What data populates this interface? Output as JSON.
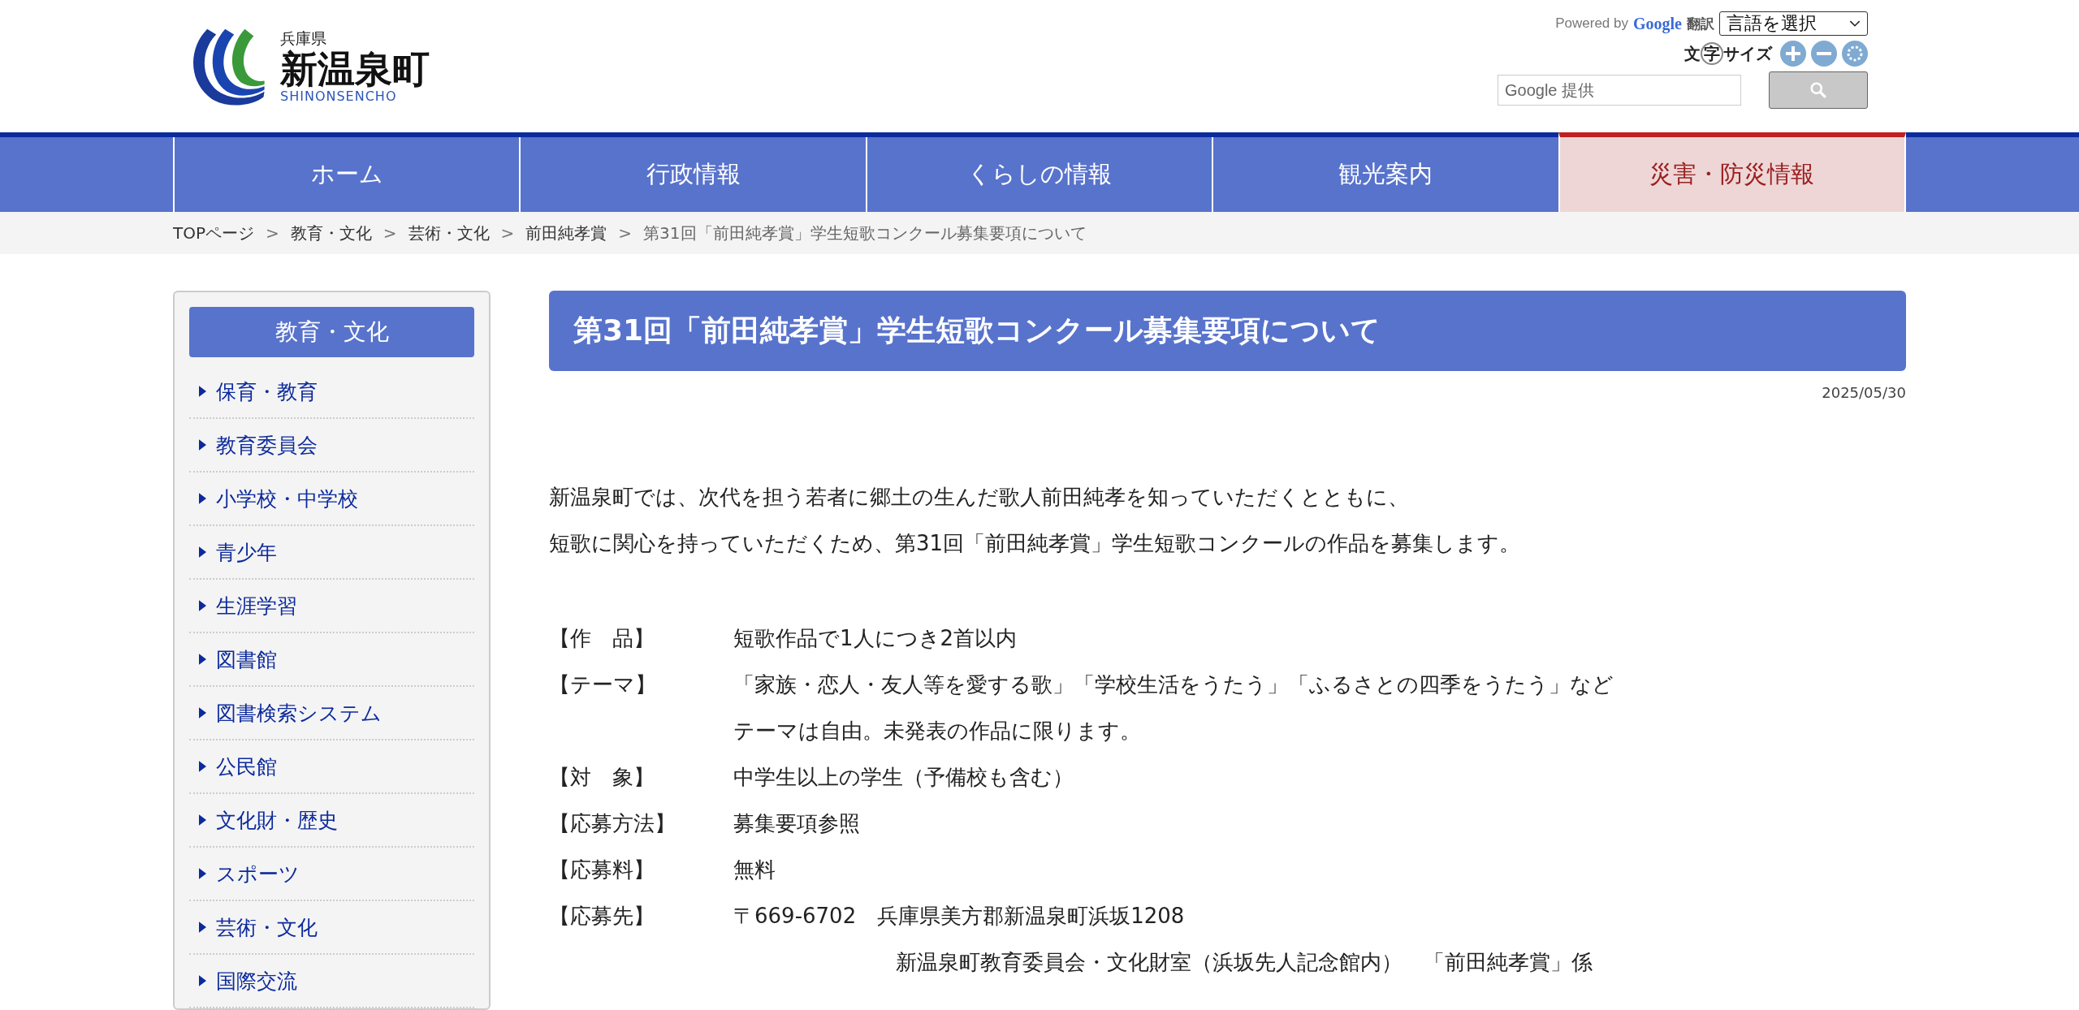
{
  "header": {
    "logo": {
      "prefecture": "兵庫県",
      "town": "新温泉町",
      "romaji": "SHINONSENCHO"
    },
    "translate": {
      "powered_by": "Powered by",
      "google": "Google",
      "translate_label": "翻訳",
      "language_select": "言語を選択"
    },
    "font_size": {
      "label_before": "文",
      "label_mark": "字",
      "label_after": "サイズ"
    },
    "search": {
      "placeholder": "Google 提供"
    }
  },
  "nav": [
    {
      "label": "ホーム",
      "kind": "normal"
    },
    {
      "label": "行政情報",
      "kind": "normal"
    },
    {
      "label": "くらしの情報",
      "kind": "normal"
    },
    {
      "label": "観光案内",
      "kind": "normal"
    },
    {
      "label": "災害・防災情報",
      "kind": "alert"
    }
  ],
  "breadcrumb": [
    {
      "label": "TOPページ",
      "current": false
    },
    {
      "label": "教育・文化",
      "current": false
    },
    {
      "label": "芸術・文化",
      "current": false
    },
    {
      "label": "前田純孝賞",
      "current": false
    },
    {
      "label": "第31回「前田純孝賞」学生短歌コンクール募集要項について",
      "current": true
    }
  ],
  "breadcrumb_separator": ">",
  "sidebar": {
    "title": "教育・文化",
    "items": [
      "保育・教育",
      "教育委員会",
      "小学校・中学校",
      "青少年",
      "生涯学習",
      "図書館",
      "図書検索システム",
      "公民館",
      "文化財・歴史",
      "スポーツ",
      "芸術・文化",
      "国際交流"
    ]
  },
  "article": {
    "title": "第31回「前田純孝賞」学生短歌コンクール募集要項について",
    "date": "2025/05/30",
    "intro": [
      "新温泉町では、次代を担う若者に郷土の生んだ歌人前田純孝を知っていただくとともに、",
      "短歌に関心を持っていただくため、第31回「前田純孝賞」学生短歌コンクールの作品を募集します。"
    ],
    "details": [
      {
        "label": "【作　品】",
        "lines": [
          "短歌作品で1人につき2首以内"
        ]
      },
      {
        "label": "【テーマ】",
        "lines": [
          "「家族・恋人・友人等を愛する歌」「学校生活をうたう」「ふるさとの四季をうたう」など",
          "テーマは自由。未発表の作品に限ります。"
        ]
      },
      {
        "label": "【対　象】",
        "lines": [
          "中学生以上の学生（予備校も含む）"
        ]
      },
      {
        "label": "【応募方法】",
        "lines": [
          "募集要項参照"
        ]
      },
      {
        "label": "【応募料】",
        "lines": [
          "無料"
        ]
      },
      {
        "label": "【応募先】",
        "lines": [
          "〒669-6702　兵庫県美方郡新温泉町浜坂1208"
        ],
        "indented_lines": [
          "新温泉町教育委員会・文化財室（浜坂先人記念館内）　「前田純孝賞」係"
        ]
      }
    ]
  }
}
